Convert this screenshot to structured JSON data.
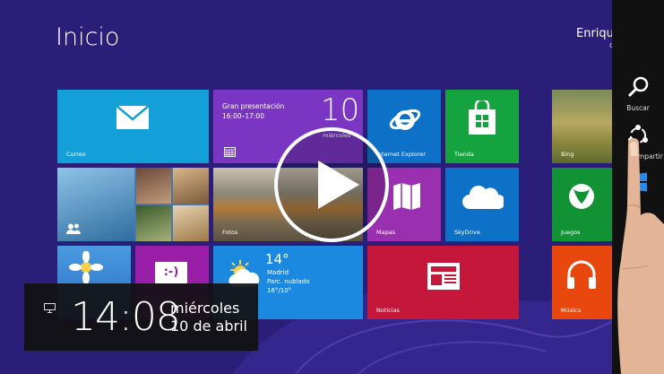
{
  "start": {
    "title": "Inicio",
    "user_name": "Enrique",
    "user_sub": "c"
  },
  "tiles": {
    "mail": "Correo",
    "calendar_event": "Gran presentación",
    "calendar_time": "16:00–17:00",
    "calendar_day_number": "10",
    "calendar_weekday": "miércoles",
    "ie": "Internet Explorer",
    "store": "Tienda",
    "bing": "Bing",
    "photos": "Fotos",
    "maps": "Mapas",
    "skydrive": "SkyDrive",
    "games": "Juegos",
    "weather_temp": "14°",
    "weather_city": "Madrid",
    "weather_cond": "Parc. nublado",
    "weather_range": "16°/10°",
    "news": "Noticias",
    "music": "Música",
    "messaging_emoticon": ":-)"
  },
  "charms": {
    "search": "Buscar",
    "share": "Compartir"
  },
  "clock": {
    "time": "14:08",
    "day": "miércoles",
    "date": "10 de abril"
  },
  "colors": {
    "background": "#2a1e78",
    "mail": "#139fd8",
    "calendar": "#7a35c2",
    "ie": "#0e71c8",
    "store": "#15a33f",
    "maps": "#9a2fb0",
    "skydrive": "#0e71c8",
    "games": "#119234",
    "weather": "#1b89e0",
    "news": "#c4173a",
    "music": "#e8470e",
    "messaging": "#9a1fa8"
  }
}
